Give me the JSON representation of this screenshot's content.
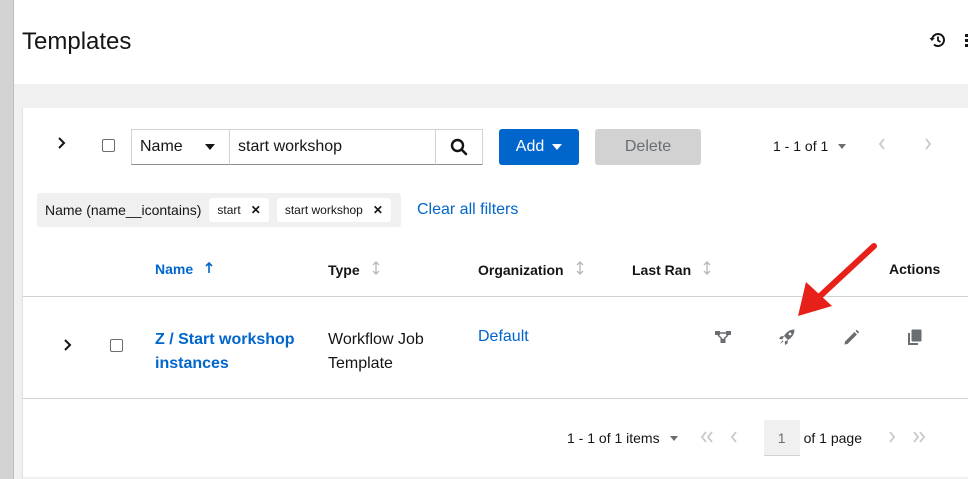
{
  "page": {
    "title": "Templates"
  },
  "header": {
    "history_icon": "history-icon"
  },
  "toolbar": {
    "filter_field": "Name",
    "search_value": "start workshop",
    "add_label": "Add",
    "delete_label": "Delete",
    "pagination_label": "1 - 1 of 1"
  },
  "filters": {
    "category_label": "Name (name__icontains)",
    "chips": [
      "start",
      "start workshop"
    ],
    "clear_label": "Clear all filters"
  },
  "table": {
    "columns": {
      "name": "Name",
      "type": "Type",
      "organization": "Organization",
      "last_ran": "Last Ran",
      "actions": "Actions"
    },
    "rows": [
      {
        "name": "Z / Start workshop instances",
        "type": "Workflow Job Template",
        "organization": "Default",
        "last_ran": ""
      }
    ]
  },
  "pagination_bottom": {
    "items_label": "1 - 1 of 1 items",
    "current_page": "1",
    "of_pages": "of 1 page"
  },
  "colors": {
    "accent": "#0066cc",
    "annotation_arrow": "#e8201a"
  }
}
